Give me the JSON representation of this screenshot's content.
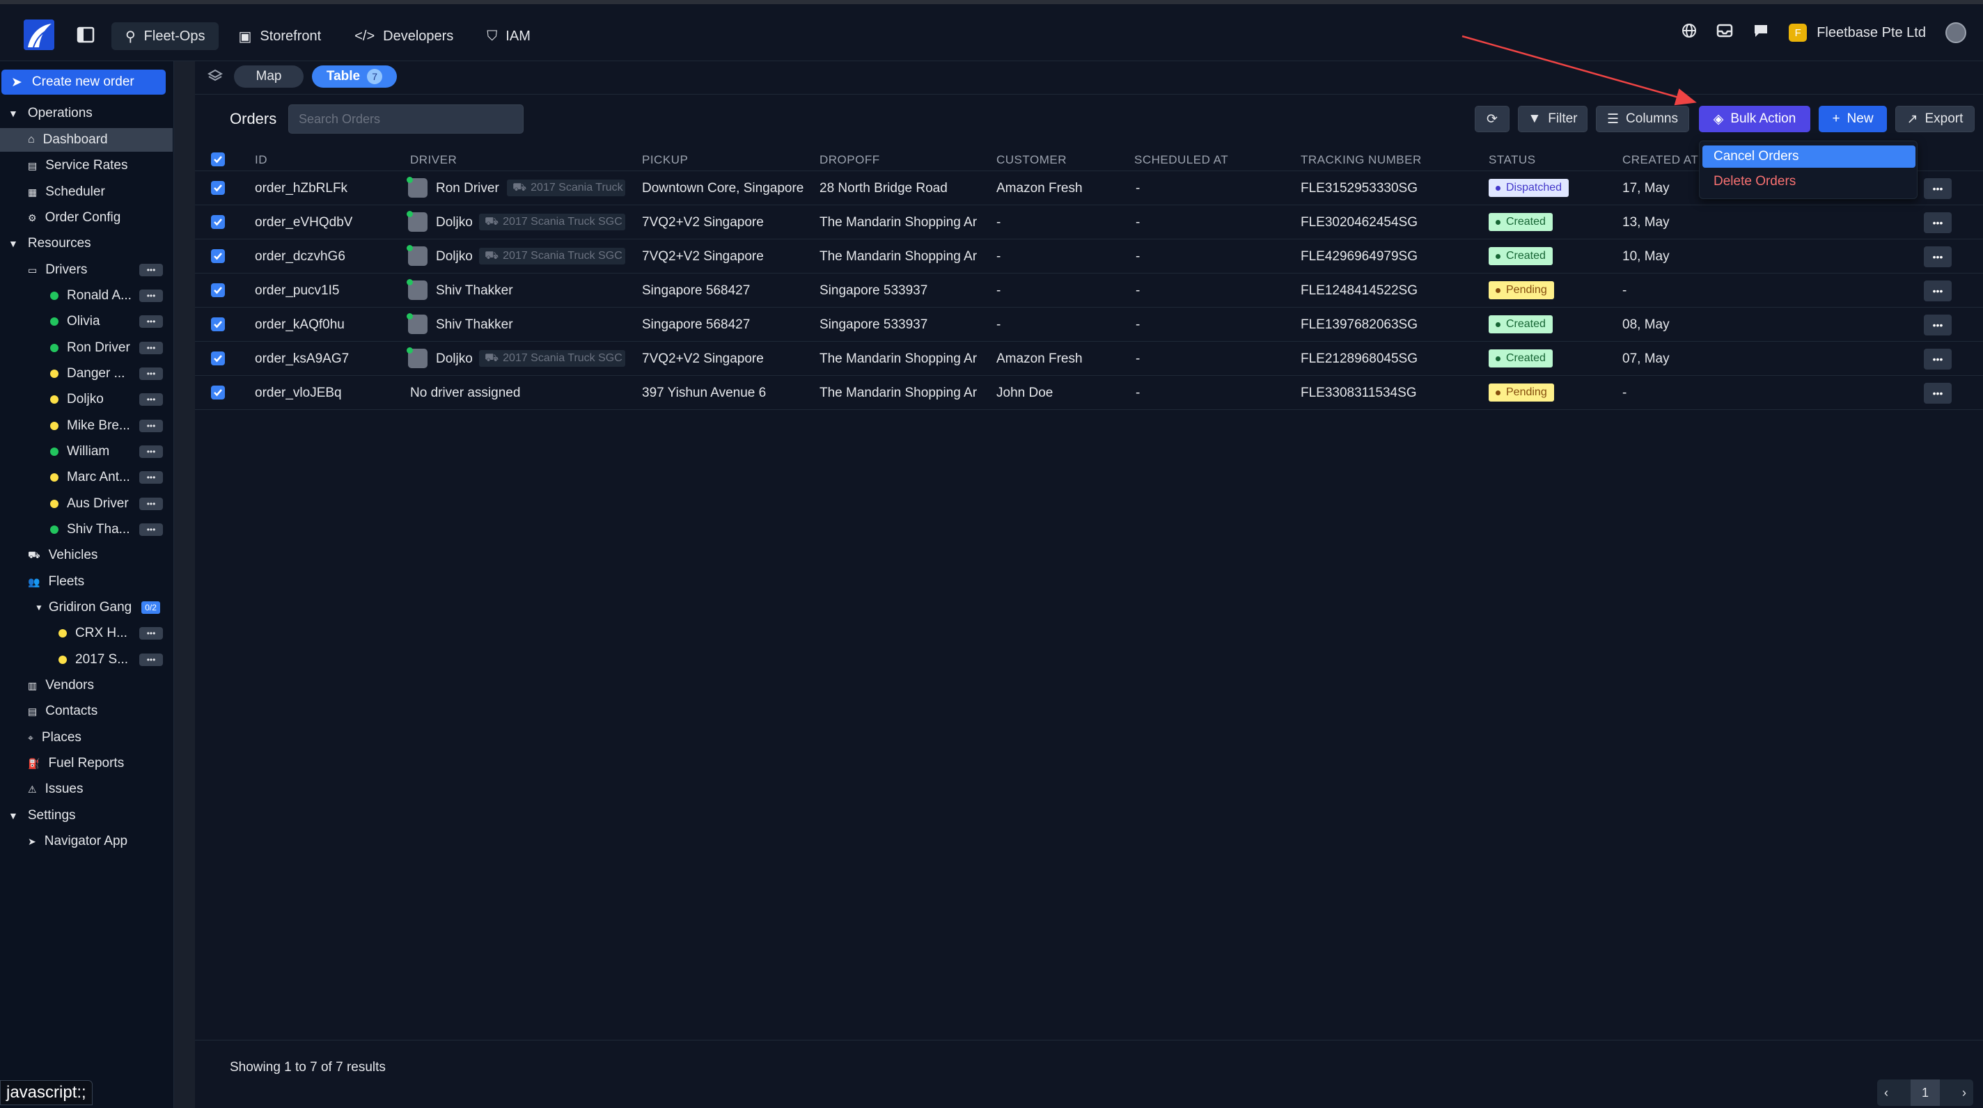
{
  "topbar": {
    "nav": [
      {
        "label": "Fleet-Ops",
        "icon": "route-icon"
      },
      {
        "label": "Storefront",
        "icon": "store-icon"
      },
      {
        "label": "Developers",
        "icon": "code-icon"
      },
      {
        "label": "IAM",
        "icon": "shield-icon"
      }
    ],
    "org_initial": "F",
    "org_name": "Fleetbase Pte Ltd"
  },
  "sidebar": {
    "create_label": "Create new order",
    "operations": {
      "label": "Operations",
      "items": [
        "Dashboard",
        "Service Rates",
        "Scheduler",
        "Order Config"
      ]
    },
    "resources": {
      "label": "Resources",
      "drivers_label": "Drivers",
      "drivers": [
        {
          "name": "Ronald A...",
          "status": "green"
        },
        {
          "name": "Olivia",
          "status": "green"
        },
        {
          "name": "Ron Driver",
          "status": "green"
        },
        {
          "name": "Danger ...",
          "status": "yellow"
        },
        {
          "name": "Doljko",
          "status": "yellow"
        },
        {
          "name": "Mike Bre...",
          "status": "yellow"
        },
        {
          "name": "William",
          "status": "green"
        },
        {
          "name": "Marc Ant...",
          "status": "yellow"
        },
        {
          "name": "Aus Driver",
          "status": "yellow"
        },
        {
          "name": "Shiv Tha...",
          "status": "green"
        }
      ],
      "vehicles_label": "Vehicles",
      "fleets_label": "Fleets",
      "fleet_name": "Gridiron Gang",
      "fleet_count": "0/2",
      "fleet_vehicles": [
        {
          "name": "CRX H...",
          "status": "yellow"
        },
        {
          "name": "2017 S...",
          "status": "yellow"
        }
      ],
      "more_items": [
        "Vendors",
        "Contacts",
        "Places",
        "Fuel Reports",
        "Issues"
      ]
    },
    "settings": {
      "label": "Settings",
      "items": [
        "Navigator App"
      ]
    }
  },
  "subtabs": {
    "map": "Map",
    "table": "Table",
    "table_count": "7"
  },
  "toolbar": {
    "title": "Orders",
    "search_placeholder": "Search Orders",
    "filter": "Filter",
    "columns": "Columns",
    "bulk_action": "Bulk Action",
    "new": "New",
    "export": "Export"
  },
  "bulk_menu": {
    "cancel": "Cancel Orders",
    "delete": "Delete Orders"
  },
  "table": {
    "columns": [
      "ID",
      "DRIVER",
      "PICKUP",
      "DROPOFF",
      "CUSTOMER",
      "SCHEDULED AT",
      "TRACKING NUMBER",
      "STATUS",
      "CREATED AT"
    ],
    "rows": [
      {
        "id": "order_hZbRLFk",
        "driver": "Ron Driver",
        "vehicle": "2017 Scania Truck",
        "pickup": "Downtown Core, Singapore",
        "dropoff": "28 North Bridge Road",
        "customer": "Amazon Fresh",
        "scheduled": "-",
        "tracking": "FLE3152953330SG",
        "status": "Dispatched",
        "status_class": "dispatched",
        "created": "17, May"
      },
      {
        "id": "order_eVHQdbV",
        "driver": "Doljko",
        "vehicle": "2017 Scania Truck SGC",
        "pickup": "7VQ2+V2 Singapore",
        "dropoff": "The Mandarin Shopping Ar",
        "customer": "-",
        "scheduled": "-",
        "tracking": "FLE3020462454SG",
        "status": "Created",
        "status_class": "created",
        "created": "13, May"
      },
      {
        "id": "order_dczvhG6",
        "driver": "Doljko",
        "vehicle": "2017 Scania Truck SGC",
        "pickup": "7VQ2+V2 Singapore",
        "dropoff": "The Mandarin Shopping Ar",
        "customer": "-",
        "scheduled": "-",
        "tracking": "FLE4296964979SG",
        "status": "Created",
        "status_class": "created",
        "created": "10, May"
      },
      {
        "id": "order_pucv1I5",
        "driver": "Shiv Thakker",
        "vehicle": "",
        "pickup": "Singapore 568427",
        "dropoff": "Singapore 533937",
        "customer": "-",
        "scheduled": "-",
        "tracking": "FLE1248414522SG",
        "status": "Pending",
        "status_class": "pending",
        "created": "-"
      },
      {
        "id": "order_kAQf0hu",
        "driver": "Shiv Thakker",
        "vehicle": "",
        "pickup": "Singapore 568427",
        "dropoff": "Singapore 533937",
        "customer": "-",
        "scheduled": "-",
        "tracking": "FLE1397682063SG",
        "status": "Created",
        "status_class": "created",
        "created": "08, May"
      },
      {
        "id": "order_ksA9AG7",
        "driver": "Doljko",
        "vehicle": "2017 Scania Truck SGC",
        "pickup": "7VQ2+V2 Singapore",
        "dropoff": "The Mandarin Shopping Ar",
        "customer": "Amazon Fresh",
        "scheduled": "-",
        "tracking": "FLE2128968045SG",
        "status": "Created",
        "status_class": "created",
        "created": "07, May"
      },
      {
        "id": "order_vloJEBq",
        "driver": "No driver assigned",
        "vehicle": "",
        "pickup": "397 Yishun Avenue 6",
        "dropoff": "The Mandarin Shopping Ar",
        "customer": "John Doe",
        "scheduled": "-",
        "tracking": "FLE3308311534SG",
        "status": "Pending",
        "status_class": "pending",
        "created": "-"
      }
    ]
  },
  "footer": {
    "results": "Showing 1 to 7 of 7 results",
    "page": "1"
  },
  "status_url": "javascript:;"
}
